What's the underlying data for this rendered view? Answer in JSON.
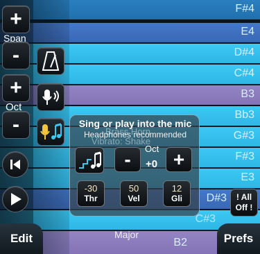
{
  "notes": [
    "F#4",
    "E4",
    "D#4",
    "C#4",
    "B3",
    "Bb3",
    "G#3",
    "F#3",
    "E3",
    "D#3",
    "C#3",
    "B2"
  ],
  "left_controls": {
    "span_label": "Span",
    "oct_label": "Oct",
    "plus_glyph": "+",
    "minus_glyph": "-"
  },
  "panel": {
    "title": "Sing or play into the mic",
    "subtitle": "Headphones recommended",
    "ghost_lines": [
      "Brass Horn",
      "Vibrato: Shake"
    ],
    "octave_label": "Oct",
    "octave_value": "+0",
    "minus_glyph": "-",
    "plus_glyph": "+",
    "controls": [
      {
        "value": "-30",
        "name": "Thr"
      },
      {
        "value": "50",
        "name": "Vel"
      },
      {
        "value": "12",
        "name": "Gli"
      }
    ]
  },
  "all_off": {
    "line1": "! All",
    "line2": "Off !"
  },
  "bottom": {
    "edit": "Edit",
    "prefs": "Prefs",
    "scale": "Major"
  },
  "icons": [
    "metronome-icon",
    "mic-sound-icon",
    "mic-note-icon",
    "skip-back-icon",
    "play-icon",
    "staircase-note-icon"
  ],
  "colors": {
    "lane_white": "#3cc9f3",
    "lane_blue": "#4478c9",
    "lane_purple": "#9384c3"
  }
}
